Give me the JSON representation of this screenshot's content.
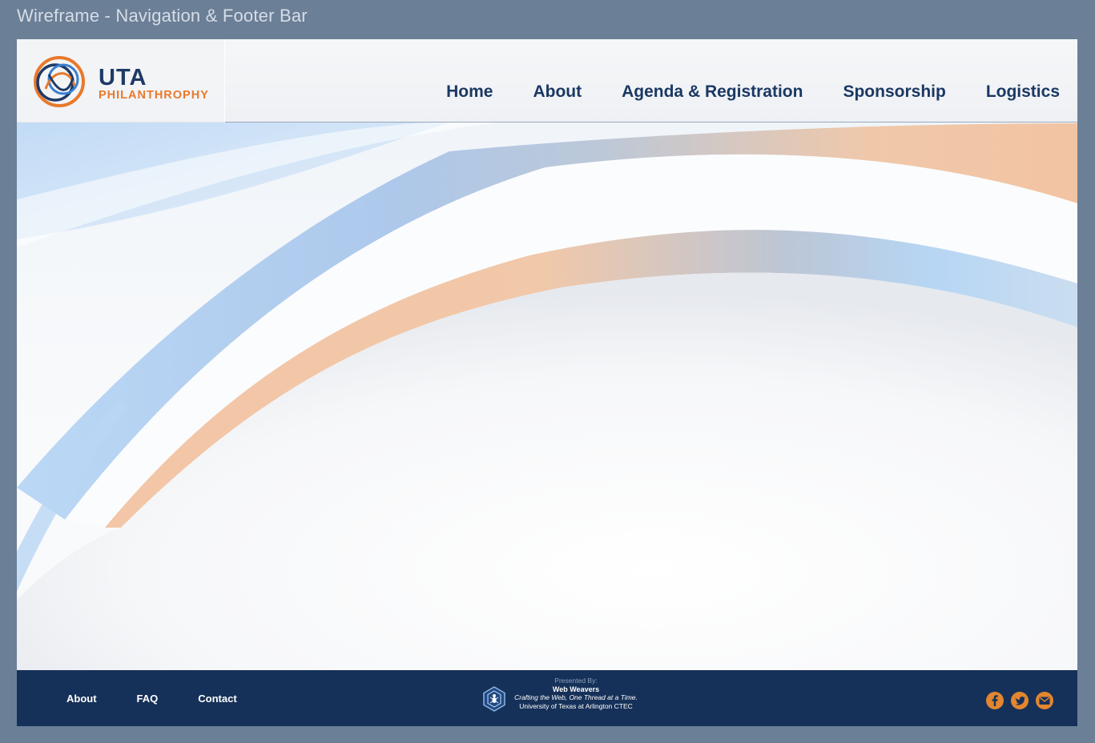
{
  "wireframe": {
    "title": "Wireframe - Navigation & Footer Bar"
  },
  "brand": {
    "name": "UTA",
    "subtitle": "PHILANTHROPHY"
  },
  "nav": {
    "items": [
      {
        "label": "Home"
      },
      {
        "label": "About"
      },
      {
        "label": "Agenda & Registration"
      },
      {
        "label": "Sponsorship"
      },
      {
        "label": "Logistics"
      }
    ]
  },
  "footer": {
    "links": [
      {
        "label": "About"
      },
      {
        "label": "FAQ"
      },
      {
        "label": "Contact"
      }
    ],
    "credit": {
      "presented_by": "Presented By:",
      "name": "Web Weavers",
      "tagline": "Crafting the Web, One Thread at a Time.",
      "org": "University of Texas at Arlington CTEC"
    },
    "socials": [
      {
        "icon": "facebook-icon"
      },
      {
        "icon": "bird-icon"
      },
      {
        "icon": "mail-icon"
      }
    ]
  },
  "colors": {
    "page_bg": "#6b7f97",
    "nav_text": "#1a3863",
    "accent_orange": "#e8792c",
    "footer_bg": "#163159",
    "social_icon": "#e3862f"
  }
}
